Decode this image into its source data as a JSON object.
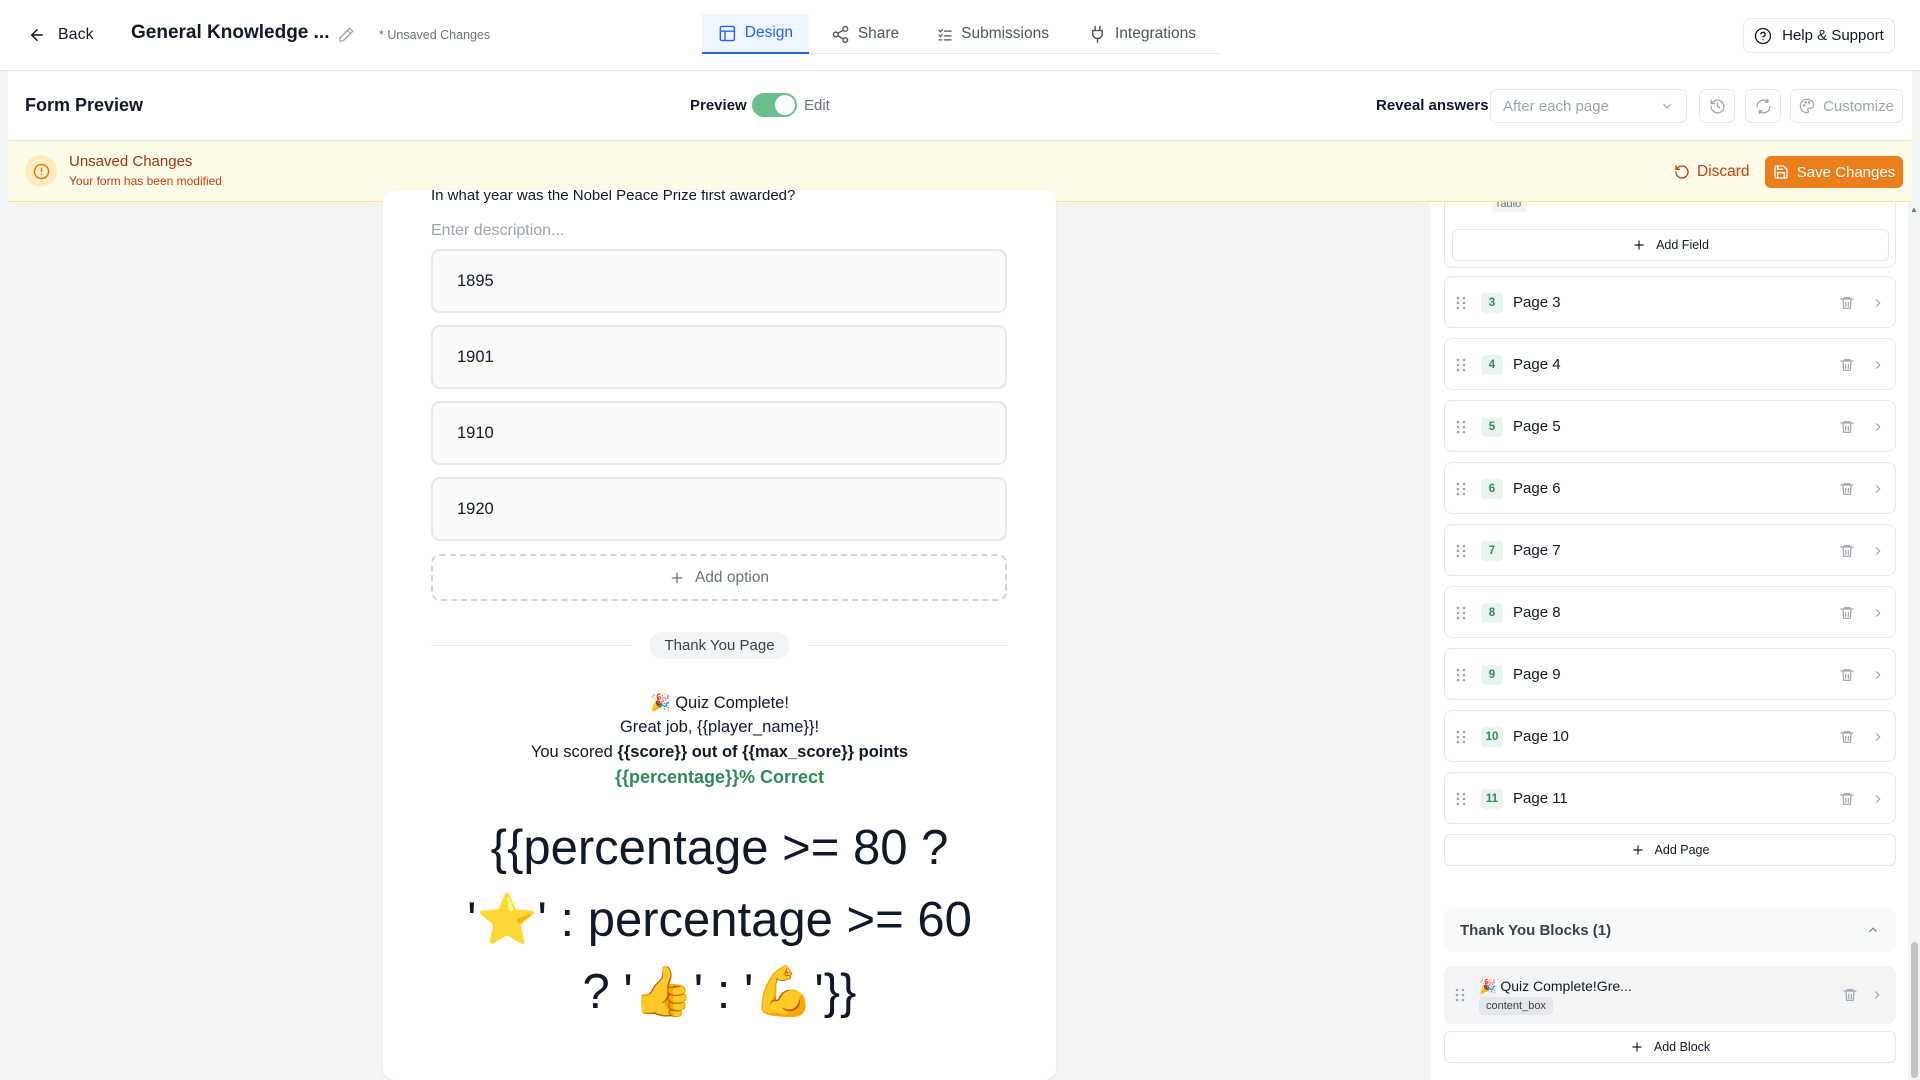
{
  "topbar": {
    "back_label": "Back",
    "form_title": "General Knowledge ...",
    "unsaved_note": "* Unsaved Changes",
    "tabs": [
      {
        "label": "Design",
        "icon": "layout-icon",
        "active": true
      },
      {
        "label": "Share",
        "icon": "share-icon",
        "active": false
      },
      {
        "label": "Submissions",
        "icon": "list-check-icon",
        "active": false
      },
      {
        "label": "Integrations",
        "icon": "plug-icon",
        "active": false
      }
    ],
    "help_label": "Help & Support"
  },
  "toolbar": {
    "title": "Form Preview",
    "preview_label": "Preview",
    "edit_label": "Edit",
    "reveal_label": "Reveal answers",
    "reveal_value": "After each page",
    "customize_label": "Customize"
  },
  "banner": {
    "title": "Unsaved Changes",
    "subtitle": "Your form has been modified",
    "discard_label": "Discard",
    "save_label": "Save Changes"
  },
  "preview": {
    "question": "In what year was the Nobel Peace Prize first awarded?",
    "description_placeholder": "Enter description...",
    "options": [
      "1895",
      "1901",
      "1910",
      "1920"
    ],
    "add_option_label": "Add option",
    "thank_you_pill": "Thank You Page",
    "thank_you": {
      "line1": "🎉 Quiz Complete!",
      "line2": "Great job, {{player_name}}!",
      "line3_prefix": "You scored ",
      "line3_bold": "{{score}} out of {{max_score}} points",
      "line4": "{{percentage}}% Correct",
      "expr_line1": "{{percentage >= 80 ?",
      "expr_line2": "'⭐' : percentage >= 60",
      "expr_line3": "? '👍' : '💪'}}"
    }
  },
  "sidebar": {
    "field_tag": "radio",
    "add_field_label": "Add Field",
    "pages": [
      {
        "num": "3",
        "label": "Page 3"
      },
      {
        "num": "4",
        "label": "Page 4"
      },
      {
        "num": "5",
        "label": "Page 5"
      },
      {
        "num": "6",
        "label": "Page 6"
      },
      {
        "num": "7",
        "label": "Page 7"
      },
      {
        "num": "8",
        "label": "Page 8"
      },
      {
        "num": "9",
        "label": "Page 9"
      },
      {
        "num": "10",
        "label": "Page 10"
      },
      {
        "num": "11",
        "label": "Page 11"
      }
    ],
    "add_page_label": "Add Page",
    "thank_you_header": "Thank You Blocks (1)",
    "block_title": "🎉 Quiz Complete!Gre...",
    "block_tag": "content_box",
    "add_block_label": "Add Block"
  },
  "colors": {
    "accent_blue": "#2563eb",
    "save_orange": "#ea7e1a",
    "toggle_green": "#6bbf8e",
    "correct_green": "#2f8a57",
    "banner_bg": "#fefbe8"
  }
}
